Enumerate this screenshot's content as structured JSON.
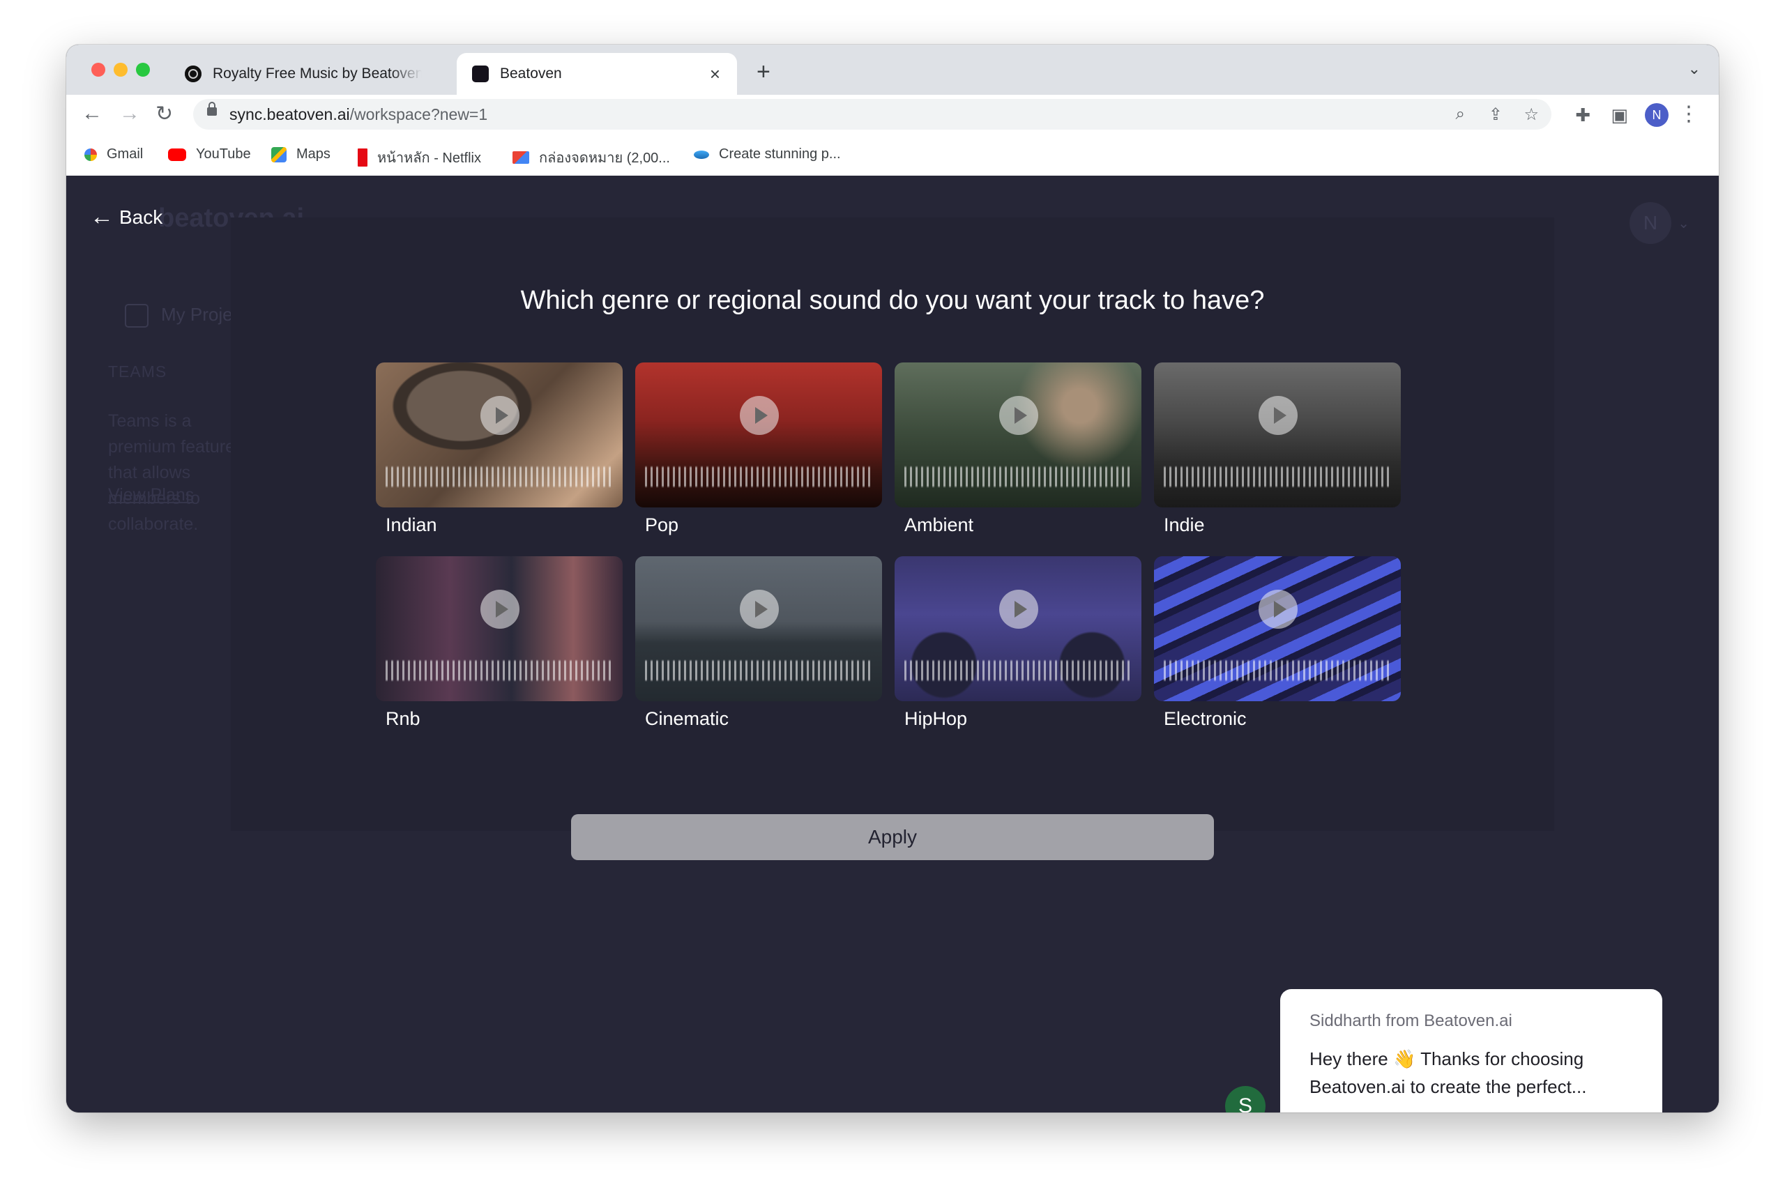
{
  "browser": {
    "tabs": [
      {
        "title": "Royalty Free Music by Beatoven.ai",
        "active": false
      },
      {
        "title": "Beatoven",
        "active": true
      }
    ],
    "url_host": "sync.beatoven.ai",
    "url_path": "/workspace?new=1",
    "profile_initial": "N",
    "bookmarks": [
      {
        "label": "Gmail",
        "icon": "google-icon"
      },
      {
        "label": "YouTube",
        "icon": "youtube-icon"
      },
      {
        "label": "Maps",
        "icon": "maps-icon"
      },
      {
        "label": "หน้าหลัก - Netflix",
        "icon": "netflix-icon"
      },
      {
        "label": "กล่องจดหมาย (2,00...",
        "icon": "gmail-icon"
      },
      {
        "label": "Create stunning p...",
        "icon": "bookmark-icon"
      }
    ]
  },
  "background": {
    "logo": "beatoven.ai",
    "avatar_initial": "N",
    "my_projects": "My Projects",
    "teams_heading": "TEAMS",
    "teams_text": "Teams is a premium feature that allows members to collaborate.",
    "view_plans": "View Plans"
  },
  "modal": {
    "back_label": "Back",
    "question": "Which genre or regional sound do you want your track to have?",
    "genres": [
      {
        "label": "Indian",
        "icon": "play-icon"
      },
      {
        "label": "Pop",
        "icon": "play-icon"
      },
      {
        "label": "Ambient",
        "icon": "play-icon"
      },
      {
        "label": "Indie",
        "icon": "play-icon"
      },
      {
        "label": "Rnb",
        "icon": "play-icon"
      },
      {
        "label": "Cinematic",
        "icon": "play-icon"
      },
      {
        "label": "HipHop",
        "icon": "play-icon"
      },
      {
        "label": "Electronic",
        "icon": "play-icon"
      }
    ],
    "apply_label": "Apply"
  },
  "chat": {
    "from": "Siddharth from Beatoven.ai",
    "message": "Hey there 👋 Thanks for choosing Beatoven.ai to create the perfect...",
    "avatar_initial": "S"
  },
  "colors": {
    "page_bg": "#262637",
    "modal_bg": "#232333",
    "apply_bg": "#a2a2a8",
    "chat_avatar": "#216b3d"
  }
}
